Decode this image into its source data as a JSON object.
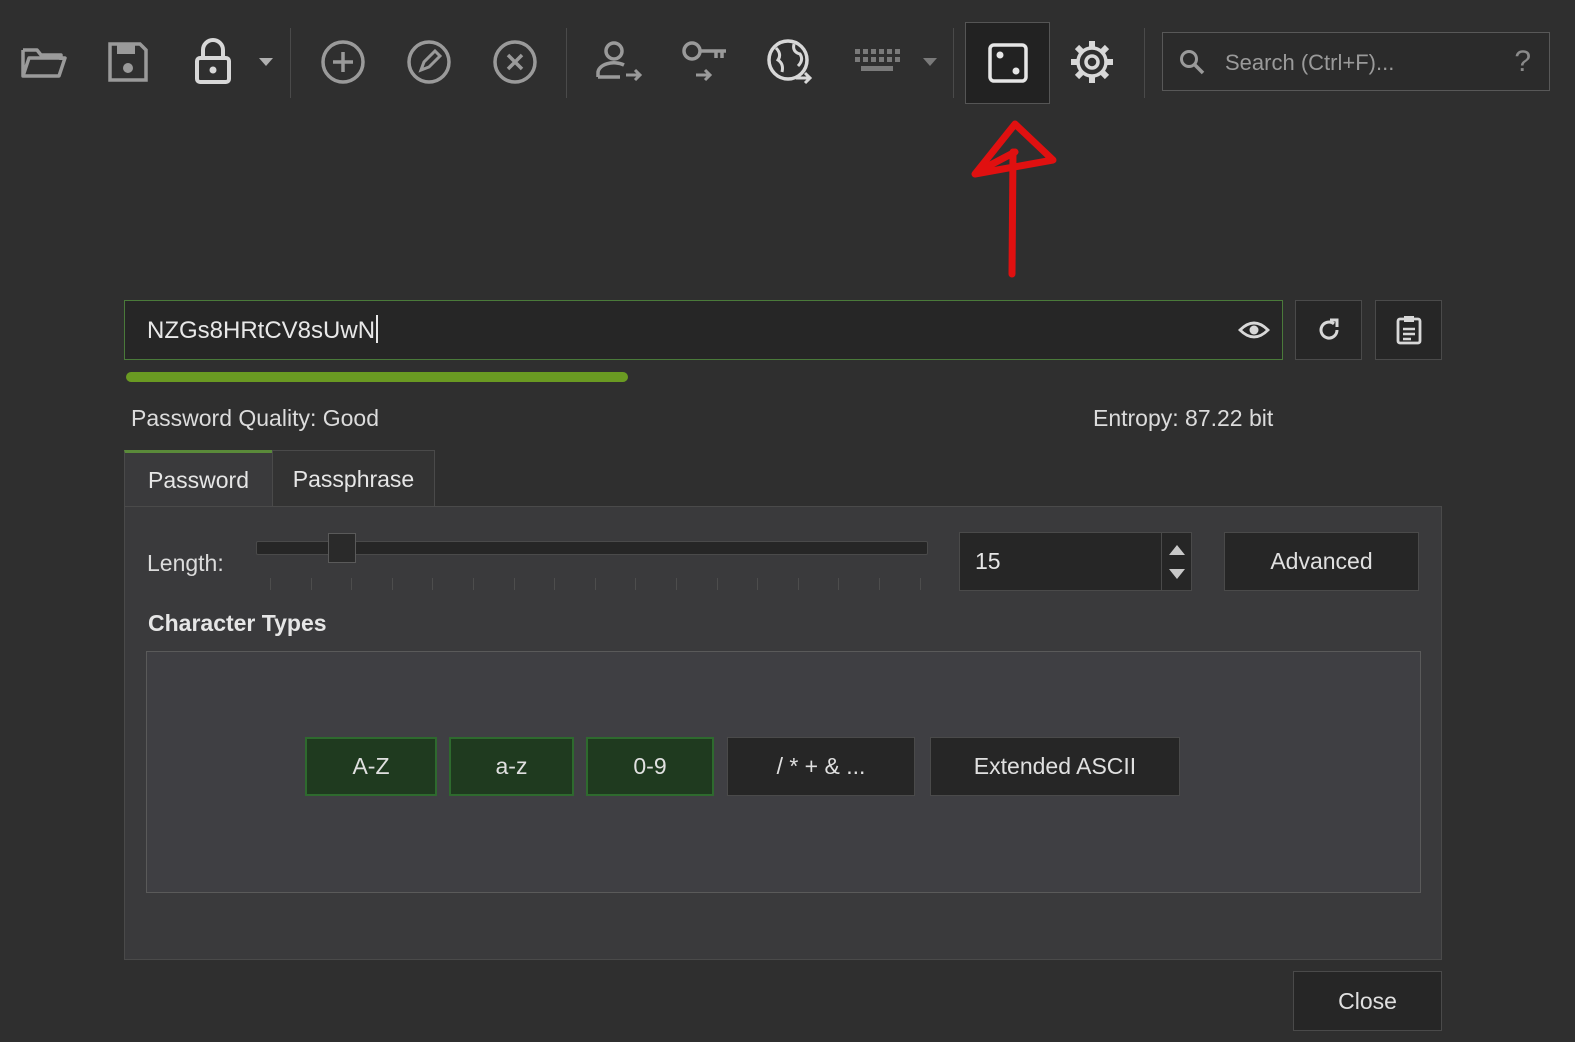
{
  "toolbar": {
    "icons": [
      "open-database-icon",
      "save-database-icon",
      "lock-database-icon",
      "add-entry-icon",
      "edit-entry-icon",
      "delete-entry-icon",
      "copy-username-icon",
      "copy-password-icon",
      "open-url-icon",
      "autotype-keyboard-icon",
      "password-generator-icon",
      "settings-gear-icon"
    ],
    "search_placeholder": "Search (Ctrl+F)...",
    "help_label": "?"
  },
  "generator": {
    "password_value": "NZGs8HRtCV8sUwN",
    "quality_label": "Password Quality: Good",
    "quality_fraction": 0.38,
    "quality_color": "#6a9a22",
    "entropy_label": "Entropy: 87.22 bit",
    "tabs": [
      {
        "label": "Password",
        "active": true
      },
      {
        "label": "Passphrase",
        "active": false
      }
    ],
    "length_label": "Length:",
    "length_value": "15",
    "advanced_label": "Advanced",
    "section_title": "Character Types",
    "char_types": [
      {
        "label": "A-Z",
        "on": true
      },
      {
        "label": "a-z",
        "on": true
      },
      {
        "label": "0-9",
        "on": true
      },
      {
        "label": "/ * + & ...",
        "on": false
      },
      {
        "label": "Extended ASCII",
        "on": false
      }
    ],
    "close_label": "Close"
  },
  "annotation": {
    "color": "#e01010"
  }
}
